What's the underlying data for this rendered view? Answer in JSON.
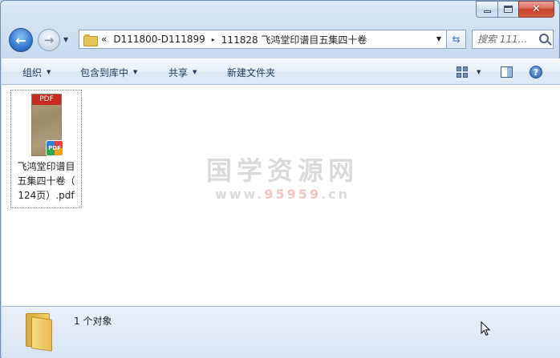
{
  "nav": {
    "back_glyph": "←",
    "forward_glyph": "→"
  },
  "address": {
    "overflow": "«",
    "crumbs": [
      "D111800-D111899",
      "111828 飞鸿堂印谱目五集四十卷"
    ],
    "separator": "▸"
  },
  "search": {
    "placeholder": "搜索 111..."
  },
  "toolbar": {
    "organize": "组织",
    "include_in_library": "包含到库中",
    "share": "共享",
    "new_folder": "新建文件夹",
    "help_glyph": "?"
  },
  "files": [
    {
      "name_lines": [
        "飞鸿堂印谱目",
        "五集四十卷（",
        "124页）.pdf"
      ],
      "thumb_label": "PDF",
      "badge_label": "PDF"
    }
  ],
  "watermark": {
    "title": "国学资源网",
    "sub_prefix": "www.",
    "sub_red": "95959",
    "sub_suffix": ".cn"
  },
  "status": {
    "count_text": "1 个对象"
  },
  "caption": {
    "close_glyph": "✕"
  }
}
